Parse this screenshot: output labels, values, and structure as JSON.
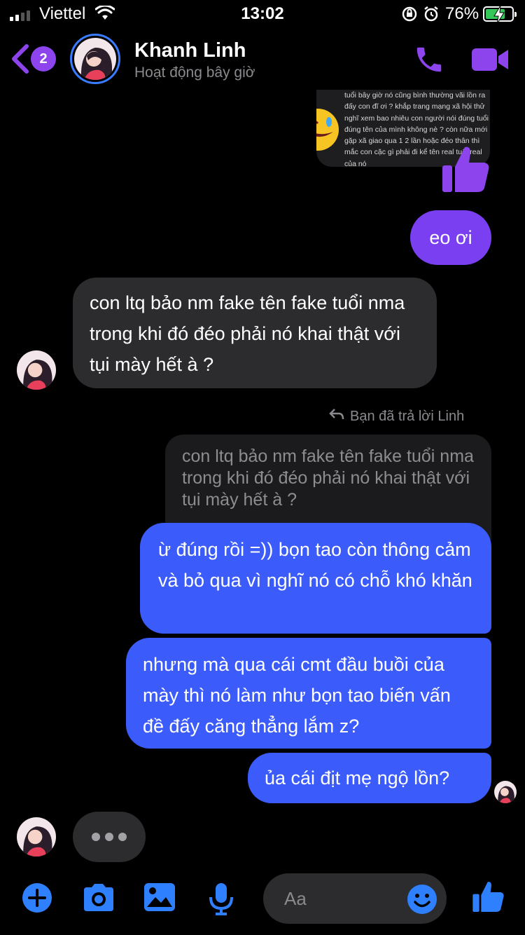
{
  "status_bar": {
    "carrier": "Viettel",
    "time": "13:02",
    "battery_percent": "76%",
    "battery_level": 0.76,
    "signal_bars": 2
  },
  "header": {
    "unread_count": "2",
    "contact_name": "Khanh Linh",
    "contact_status": "Hoạt động bây giờ",
    "accent_color": "#8e44ec"
  },
  "messages": {
    "image_text": "tuổi bây giờ nó cũng bình thường vãi lồn ra đấy con đĩ ơi ? khắp trang mạng xã hội thử nghĩ xem bao nhiêu con người nói đúng tuổi đúng tên của mình không nè ? còn nữa mới gặp xã giao qua 1 2 lần hoặc đéo thân thì mắc con cặc gì phải đi kể tên real tuổi real của nó",
    "msg1": "eo ơi",
    "msg2": "con ltq bảo nm fake tên fake tuổi nma trong khi đó đéo phải nó khai thật với tụi mày hết à ?",
    "reply_note": "Bạn đã trả lời Linh",
    "quoted": "con ltq bảo nm fake tên fake tuổi nma trong khi đó đéo phải nó khai thật với tụi mày hết à ?",
    "msg4": "ừ đúng rồi =)) bọn tao còn thông cảm và bỏ qua vì nghĩ nó có chỗ khó khăn",
    "msg5": "nhưng mà qua cái cmt đầu buồi của mày thì nó làm như bọn tao biến vấn đề đấy căng thẳng lắm z?",
    "msg6": "ủa cái địt mẹ ngộ lồn?"
  },
  "composer": {
    "placeholder": "Aa",
    "icon_color": "#2f80ff"
  },
  "colors": {
    "outgoing_purple": "#7b3ff2",
    "outgoing_blue": "#3b5cfb",
    "incoming": "#2c2c2e"
  }
}
